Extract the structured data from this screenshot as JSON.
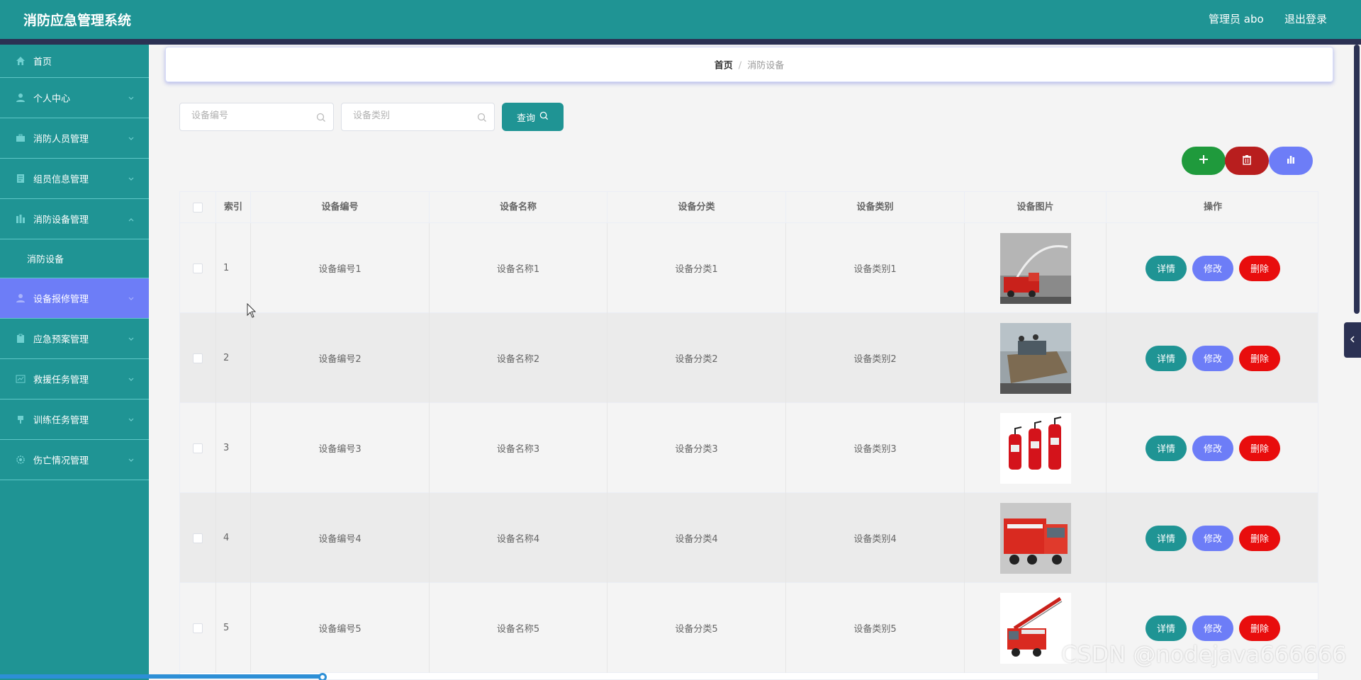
{
  "header": {
    "app_title": "消防应急管理系统",
    "user_label": "管理员 abo",
    "logout_label": "退出登录"
  },
  "colors": {
    "primary": "#1f9494",
    "header_band": "#2b3153",
    "active_menu": "#6d7df7",
    "add": "#1f9a3c",
    "delete_all": "#b81e1e",
    "chart": "#6d7df7",
    "row_delete": "#e80d0d"
  },
  "sidebar": {
    "items": [
      {
        "label": "首页",
        "icon": "home-icon"
      },
      {
        "label": "个人中心",
        "icon": "user-icon"
      },
      {
        "label": "消防人员管理",
        "icon": "briefcase-icon"
      },
      {
        "label": "组员信息管理",
        "icon": "document-icon"
      },
      {
        "label": "消防设备管理",
        "icon": "building-icon",
        "expanded": true
      },
      {
        "label": "消防设备",
        "submenu": true
      },
      {
        "label": "设备报修管理",
        "icon": "user-icon",
        "active": true
      },
      {
        "label": "应急预案管理",
        "icon": "clipboard-icon"
      },
      {
        "label": "救援任务管理",
        "icon": "chart-icon"
      },
      {
        "label": "训练任务管理",
        "icon": "flag-icon"
      },
      {
        "label": "伤亡情况管理",
        "icon": "gear-icon"
      }
    ]
  },
  "breadcrumb": {
    "home": "首页",
    "separator": "/",
    "current": "消防设备"
  },
  "search": {
    "code_placeholder": "设备编号",
    "type_placeholder": "设备类别",
    "button_label": "查询"
  },
  "table": {
    "headers": [
      "索引",
      "设备编号",
      "设备名称",
      "设备分类",
      "设备类别",
      "设备图片",
      "操作"
    ],
    "rows": [
      {
        "index": "1",
        "code": "设备编号1",
        "name": "设备名称1",
        "category": "设备分类1",
        "type": "设备类别1",
        "image": "fire-truck-spraying-photo"
      },
      {
        "index": "2",
        "code": "设备编号2",
        "name": "设备名称2",
        "category": "设备分类2",
        "type": "设备类别2",
        "image": "armored-vehicle-photo"
      },
      {
        "index": "3",
        "code": "设备编号3",
        "name": "设备名称3",
        "category": "设备分类3",
        "type": "设备类别3",
        "image": "fire-extinguishers-photo"
      },
      {
        "index": "4",
        "code": "设备编号4",
        "name": "设备名称4",
        "category": "设备分类4",
        "type": "设备类别4",
        "image": "fire-engine-photo"
      },
      {
        "index": "5",
        "code": "设备编号5",
        "name": "设备名称5",
        "category": "设备分类5",
        "type": "设备类别5",
        "image": "ladder-truck-photo"
      }
    ],
    "actions": {
      "detail": "详情",
      "edit": "修改",
      "delete": "删除"
    }
  },
  "watermark": "CSDN @nodejava666666"
}
